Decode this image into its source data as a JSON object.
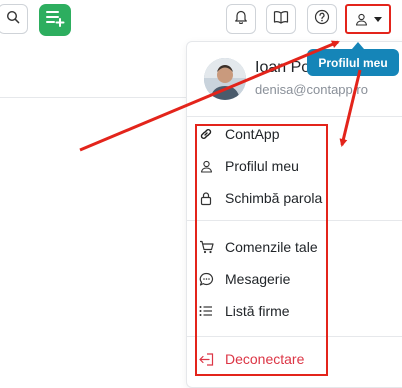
{
  "header": {
    "icons": [
      "search-icon",
      "add-list-icon",
      "bell-icon",
      "book-icon",
      "help-icon",
      "user-icon",
      "caret-down-icon"
    ]
  },
  "user_menu": {
    "name": "Ioan Po",
    "email": "denisa@contapp.ro",
    "tooltip": "Profilul meu",
    "items": [
      {
        "label": "ContApp",
        "icon": "link-icon"
      },
      {
        "label": "Profilul meu",
        "icon": "user-icon"
      },
      {
        "label": "Schimbă parola",
        "icon": "lock-icon"
      },
      {
        "label": "Comenzile tale",
        "icon": "cart-icon"
      },
      {
        "label": "Mesagerie",
        "icon": "chat-icon"
      },
      {
        "label": "Listă firme",
        "icon": "list-icon"
      },
      {
        "label": "Deconectare",
        "icon": "logout-icon"
      }
    ]
  },
  "colors": {
    "accent_green": "#2dae5f",
    "tooltip_blue": "#1585b8",
    "annotation_red": "#e3241b",
    "danger": "#dc3545"
  }
}
